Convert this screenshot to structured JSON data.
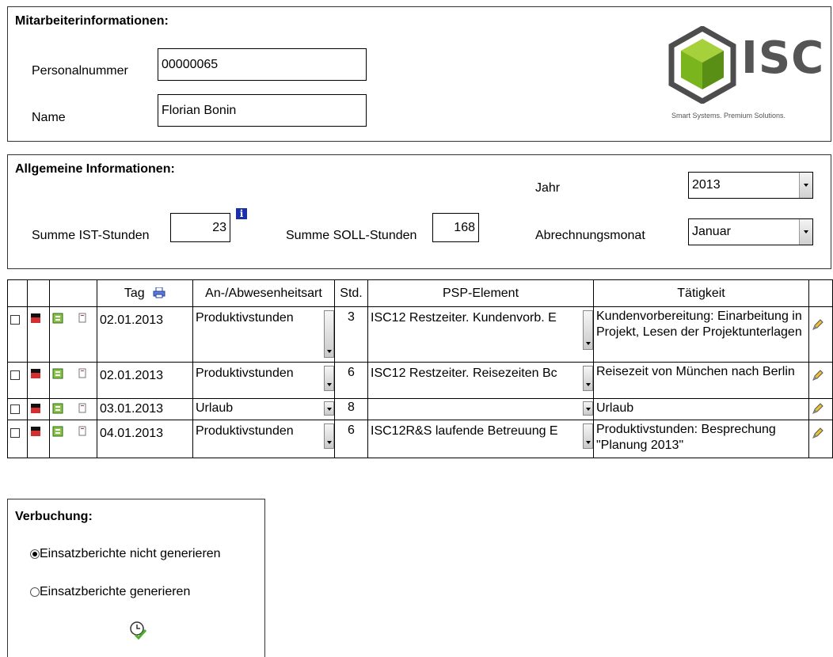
{
  "employee": {
    "title": "Mitarbeiterinformationen:",
    "personal_label": "Personalnummer",
    "personal_value": "00000065",
    "name_label": "Name",
    "name_value": "Florian Bonin"
  },
  "logo": {
    "text": "ISC",
    "tagline": "Smart Systems. Premium Solutions.",
    "colors": {
      "green": "#7ab51d",
      "gray": "#555555"
    }
  },
  "general": {
    "title": "Allgemeine Informationen:",
    "ist_label": "Summe IST-Stunden",
    "ist_value": "23",
    "info_icon": "i",
    "soll_label": "Summe SOLL-Stunden",
    "soll_value": "168",
    "year_label": "Jahr",
    "year_value": "2013",
    "month_label": "Abrechnungsmonat",
    "month_value": "Januar"
  },
  "table": {
    "headers": {
      "tag": "Tag",
      "type": "An-/Abwesenheitsart",
      "hours": "Std.",
      "psp": "PSP-Element",
      "activity": "Tätigkeit"
    },
    "rows": [
      {
        "date": "02.01.2013",
        "type": "Produktivstunden",
        "hours": "3",
        "psp": "ISC12 Restzeiter. Kundenvorb. E",
        "activity": "Kundenvorbereitung: Einarbeitung in Projekt, Lesen der Projektunterlagen"
      },
      {
        "date": "02.01.2013",
        "type": "Produktivstunden",
        "hours": "6",
        "psp": "ISC12 Restzeiter. Reisezeiten Bc",
        "activity": "Reisezeit von München nach Berlin"
      },
      {
        "date": "03.01.2013",
        "type": "Urlaub",
        "hours": "8",
        "psp": "",
        "activity": "Urlaub"
      },
      {
        "date": "04.01.2013",
        "type": "Produktivstunden",
        "hours": "6",
        "psp": "ISC12R&S laufende Betreuung E",
        "activity": "Produktivstunden: Besprechung \"Planung 2013\""
      }
    ]
  },
  "booking": {
    "title": "Verbuchung:",
    "option1": "Einsatzberichte nicht generieren",
    "option2": "Einsatzberichte generieren",
    "selected": 1
  }
}
